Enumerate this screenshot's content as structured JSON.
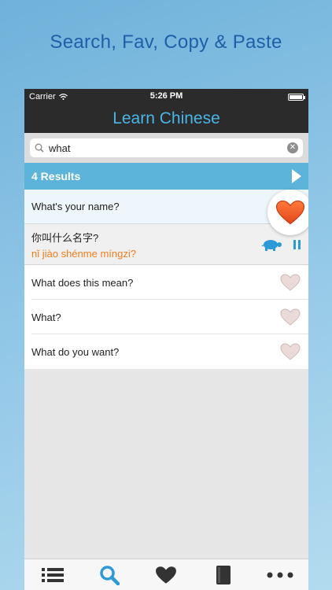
{
  "headline": "Search, Fav, Copy & Paste",
  "status": {
    "carrier": "Carrier",
    "time": "5:26 PM"
  },
  "nav": {
    "title": "Learn Chinese"
  },
  "search": {
    "value": "what"
  },
  "results": {
    "count_label": "4 Results"
  },
  "rows": [
    {
      "label": "What's your name?"
    },
    {
      "label": "What does this mean?"
    },
    {
      "label": "What?"
    },
    {
      "label": "What do you want?"
    }
  ],
  "detail": {
    "hanzi": "你叫什么名字?",
    "pinyin": "nǐ jiào shénme míngzi?"
  },
  "icons": {
    "search": "search-icon",
    "clear": "clear-icon",
    "play": "play-icon",
    "turtle": "turtle-icon",
    "pause": "pause-icon",
    "heart": "heart-icon",
    "tabs": [
      "list-icon",
      "search-icon",
      "heart-icon",
      "book-icon",
      "more-icon"
    ]
  },
  "colors": {
    "accent": "#48b6e6",
    "orange": "#f07d1b",
    "heart_active": "#f15a22",
    "heart_inactive": "#e8d6d3",
    "results_bar": "#5db4da",
    "tab_active": "#2c9ad6"
  },
  "tabs": {
    "selected_index": 1
  }
}
